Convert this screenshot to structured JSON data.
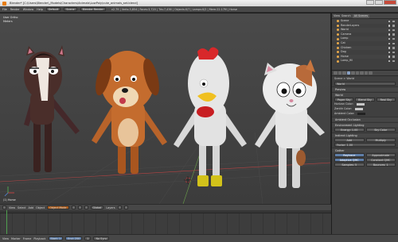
{
  "window": {
    "title": "Blender* [C:\\Users\\Blender\\_Models\\Characters\\Animals\\LowPoly\\cute_animals_set.blend]"
  },
  "topbar": {
    "menus": [
      "File",
      "Render",
      "Window",
      "Help"
    ],
    "layout": "Default",
    "scene": "Scene",
    "engine": "Blender Render",
    "stats": "v2.79 | Verts:3,854 | Faces:3,720 | Tris:7,436 | Objects:0/7 | Lamps:0/2 | Mem:22.17M | Horse"
  },
  "viewport": {
    "view_label": "User Ortho",
    "units": "Meters",
    "object_label": "(1) Horse",
    "colors": {
      "horse": "#4a2e2a",
      "dog": "#c46c2e",
      "chicken": "#e4e4e4",
      "cat": "#e8e8e8",
      "crest": "#d8282a",
      "ground": "#3a3a3a"
    }
  },
  "vp_header": {
    "view": "View",
    "select": "Select",
    "add": "Add",
    "object": "Object",
    "mode": "Object Mode",
    "pivot": "Global",
    "layers": "Layers"
  },
  "outliner": {
    "view": "View",
    "search": "Search",
    "filter": "All Scenes",
    "items": [
      "Scene",
      "RenderLayers",
      "World",
      "Camera",
      "Lamp",
      "Cat",
      "Chicken",
      "Dog",
      "Horse",
      "Lamp_fill"
    ]
  },
  "properties": {
    "breadcrumb": "Scene > World",
    "world_name": "World",
    "panel_preview": "Preview",
    "panel_world": "World",
    "horizon_label": "Horizon Color:",
    "zenith_label": "Zenith Color:",
    "ambient_label": "Ambient Color:",
    "paper_sky": "Paper Sky",
    "blend_sky": "Blend Sky",
    "real_sky": "Real Sky",
    "panel_ao": "Ambient Occlusion",
    "panel_env": "Environment Lighting",
    "add": "Add",
    "multiply": "Multiply",
    "factor_label": "Factor: 1.00",
    "energy_label": "Energy: 1.00",
    "sky_color": "Sky Color",
    "panel_indirect": "Indirect Lighting",
    "panel_gather": "Gather",
    "raytrace": "Raytrace",
    "approximate": "Approximate",
    "samples_label": "Samples: 5",
    "bounces_label": "Bounces: 1",
    "adaptive_qmc": "Adaptive QMC",
    "constant_qmc": "Constant QMC"
  },
  "timeline": {
    "view": "View",
    "marker": "Marker",
    "frame": "Frame",
    "playback": "Playback",
    "start": "Start: 1",
    "end": "End: 250",
    "current": "1",
    "sync": "No Sync"
  }
}
